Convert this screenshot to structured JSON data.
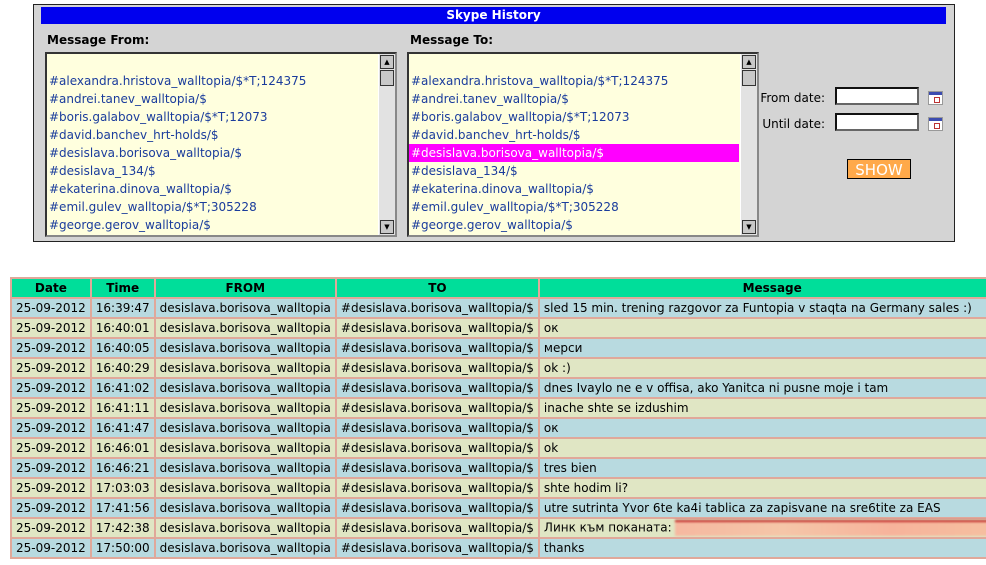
{
  "title": "Skype History",
  "from_label": "Message From:",
  "to_label": "Message To:",
  "contacts": [
    "",
    "#alexandra.hristova_walltopia/$*T;124375",
    "#andrei.tanev_walltopia/$",
    "#boris.galabov_walltopia/$*T;12073",
    "#david.banchev_hrt-holds/$",
    "#desislava.borisova_walltopia/$",
    "#desislava_134/$",
    "#ekaterina.dinova_walltopia/$",
    "#emil.gulev_walltopia/$*T;305228",
    "#george.gerov_walltopia/$"
  ],
  "selected_to": "#desislava.borisova_walltopia/$",
  "from_date_label": "From date:",
  "until_date_label": "Until date:",
  "from_date_value": "",
  "until_date_value": "",
  "show_label": "SHOW",
  "columns": [
    "Date",
    "Time",
    "FROM",
    "TO",
    "Message"
  ],
  "rows": [
    [
      "25-09-2012",
      "16:39:47",
      "desislava.borisova_walltopia",
      "#desislava.borisova_walltopia/$",
      "sled 15 min. trening razgovor za Funtopia v staqta na Germany sales :)"
    ],
    [
      "25-09-2012",
      "16:40:01",
      "desislava.borisova_walltopia",
      "#desislava.borisova_walltopia/$",
      "ок"
    ],
    [
      "25-09-2012",
      "16:40:05",
      "desislava.borisova_walltopia",
      "#desislava.borisova_walltopia/$",
      "мерси"
    ],
    [
      "25-09-2012",
      "16:40:29",
      "desislava.borisova_walltopia",
      "#desislava.borisova_walltopia/$",
      "ok :)"
    ],
    [
      "25-09-2012",
      "16:41:02",
      "desislava.borisova_walltopia",
      "#desislava.borisova_walltopia/$",
      "dnes Ivaylo ne e v offisa, ako Yanitca ni pusne moje i tam"
    ],
    [
      "25-09-2012",
      "16:41:11",
      "desislava.borisova_walltopia",
      "#desislava.borisova_walltopia/$",
      "inache shte se izdushim"
    ],
    [
      "25-09-2012",
      "16:41:47",
      "desislava.borisova_walltopia",
      "#desislava.borisova_walltopia/$",
      "ок"
    ],
    [
      "25-09-2012",
      "16:46:01",
      "desislava.borisova_walltopia",
      "#desislava.borisova_walltopia/$",
      "ok"
    ],
    [
      "25-09-2012",
      "16:46:21",
      "desislava.borisova_walltopia",
      "#desislava.borisova_walltopia/$",
      "tres bien"
    ],
    [
      "25-09-2012",
      "17:03:03",
      "desislava.borisova_walltopia",
      "#desislava.borisova_walltopia/$",
      "shte hodim li?"
    ],
    [
      "25-09-2012",
      "17:41:56",
      "desislava.borisova_walltopia",
      "#desislava.borisova_walltopia/$",
      "utre sutrinta Yvor 6te ka4i tablica za zapisvane na sre6tite za EAS"
    ],
    [
      "25-09-2012",
      "17:42:38",
      "desislava.borisova_walltopia",
      "#desislava.borisova_walltopia/$",
      "Линк към поканата:"
    ],
    [
      "25-09-2012",
      "17:50:00",
      "desislava.borisova_walltopia",
      "#desislava.borisova_walltopia/$",
      "thanks"
    ]
  ]
}
